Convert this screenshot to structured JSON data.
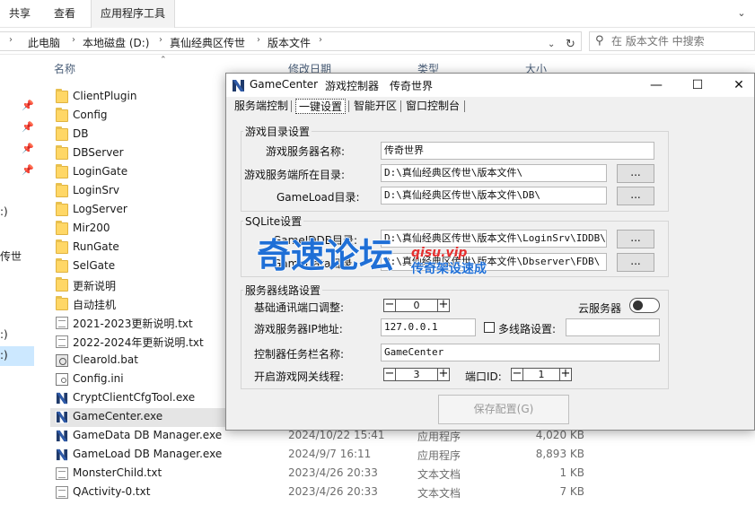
{
  "ribbon": {
    "tabs": [
      "共享",
      "查看",
      "应用程序工具"
    ]
  },
  "address": {
    "crumbs": [
      "此电脑",
      "本地磁盘 (D:)",
      "真仙经典区传世",
      "版本文件"
    ],
    "search_placeholder": "在 版本文件 中搜索"
  },
  "nav": {
    "items": [
      ":)",
      "传世",
      ":)",
      ":)"
    ]
  },
  "columns": {
    "name": "名称",
    "date": "修改日期",
    "type": "类型",
    "size": "大小"
  },
  "files": [
    {
      "name": "ClientPlugin",
      "icon": "folder",
      "date": "",
      "type": "",
      "size": ""
    },
    {
      "name": "Config",
      "icon": "folder",
      "date": "",
      "type": "",
      "size": ""
    },
    {
      "name": "DB",
      "icon": "folder",
      "date": "",
      "type": "",
      "size": ""
    },
    {
      "name": "DBServer",
      "icon": "folder",
      "date": "",
      "type": "",
      "size": ""
    },
    {
      "name": "LoginGate",
      "icon": "folder",
      "date": "",
      "type": "",
      "size": ""
    },
    {
      "name": "LoginSrv",
      "icon": "folder",
      "date": "",
      "type": "",
      "size": ""
    },
    {
      "name": "LogServer",
      "icon": "folder",
      "date": "",
      "type": "",
      "size": ""
    },
    {
      "name": "Mir200",
      "icon": "folder",
      "date": "",
      "type": "",
      "size": ""
    },
    {
      "name": "RunGate",
      "icon": "folder",
      "date": "",
      "type": "",
      "size": ""
    },
    {
      "name": "SelGate",
      "icon": "folder",
      "date": "",
      "type": "",
      "size": ""
    },
    {
      "name": "更新说明",
      "icon": "folder",
      "date": "",
      "type": "",
      "size": ""
    },
    {
      "name": "自动挂机",
      "icon": "folder",
      "date": "",
      "type": "",
      "size": ""
    },
    {
      "name": "2021-2023更新说明.txt",
      "icon": "doc",
      "date": "",
      "type": "",
      "size": ""
    },
    {
      "name": "2022-2024年更新说明.txt",
      "icon": "doc",
      "date": "",
      "type": "",
      "size": ""
    },
    {
      "name": "Clearold.bat",
      "icon": "bat",
      "date": "",
      "type": "",
      "size": ""
    },
    {
      "name": "Config.ini",
      "icon": "ini",
      "date": "",
      "type": "",
      "size": ""
    },
    {
      "name": "CryptClientCfgTool.exe",
      "icon": "exe",
      "date": "",
      "type": "",
      "size": ""
    },
    {
      "name": "GameCenter.exe",
      "icon": "exe",
      "date": "",
      "type": "",
      "size": ""
    },
    {
      "name": "GameData DB Manager.exe",
      "icon": "exe",
      "date": "2024/10/22 15:41",
      "type": "应用程序",
      "size": "4,020 KB"
    },
    {
      "name": "GameLoad DB Manager.exe",
      "icon": "exe",
      "date": "2024/9/7 16:11",
      "type": "应用程序",
      "size": "8,893 KB"
    },
    {
      "name": "MonsterChild.txt",
      "icon": "doc",
      "date": "2023/4/26 20:33",
      "type": "文本文档",
      "size": "1 KB"
    },
    {
      "name": "QActivity-0.txt",
      "icon": "doc",
      "date": "2023/4/26 20:33",
      "type": "文本文档",
      "size": "7 KB"
    }
  ],
  "window": {
    "title": "GameCenter",
    "menu": [
      "游戏控制器",
      "传奇世界"
    ],
    "controls": {
      "minimize": "—",
      "maximize": "☐",
      "close": "✕"
    },
    "tabs": [
      "服务端控制",
      "一键设置",
      "智能开区",
      "窗口控制台"
    ],
    "group_dirs": {
      "label": "游戏目录设置",
      "server_name_label": "游戏服务器名称:",
      "server_name_value": "传奇世界",
      "server_dir_label": "游戏服务端所在目录:",
      "server_dir_value": "D:\\真仙经典区传世\\版本文件\\",
      "gameload_label": "GameLoad目录:",
      "gameload_value": "D:\\真仙经典区传世\\版本文件\\DB\\",
      "browse": "..."
    },
    "group_sqlite": {
      "label": "SQLite设置",
      "iddb_label": "GameIDDB目录:",
      "iddb_value": "D:\\真仙经典区传世\\版本文件\\LoginSrv\\IDDB\\",
      "fdb_label": "GameData目录:",
      "fdb_value": "D:\\真仙经典区传世\\版本文件\\Dbserver\\FDB\\"
    },
    "group_line": {
      "label": "服务器线路设置",
      "port_adjust_label": "基础通讯端口调整:",
      "port_adjust_value": "0",
      "cloud_label": "云服务器",
      "ip_label": "游戏服务器IP地址:",
      "ip_value": "127.0.0.1",
      "multiline_label": "多线路设置:",
      "multiline_value": "",
      "taskbar_label": "控制器任务栏名称:",
      "taskbar_value": "GameCenter",
      "threads_label": "开启游戏网关线程:",
      "threads_value": "3",
      "port_id_label": "端口ID:",
      "port_id_value": "1"
    },
    "save_label": "保存配置(G)"
  },
  "watermark": {
    "main": "奇速论坛",
    "site": "qisu.vip",
    "slogan": "传奇架设速成"
  }
}
